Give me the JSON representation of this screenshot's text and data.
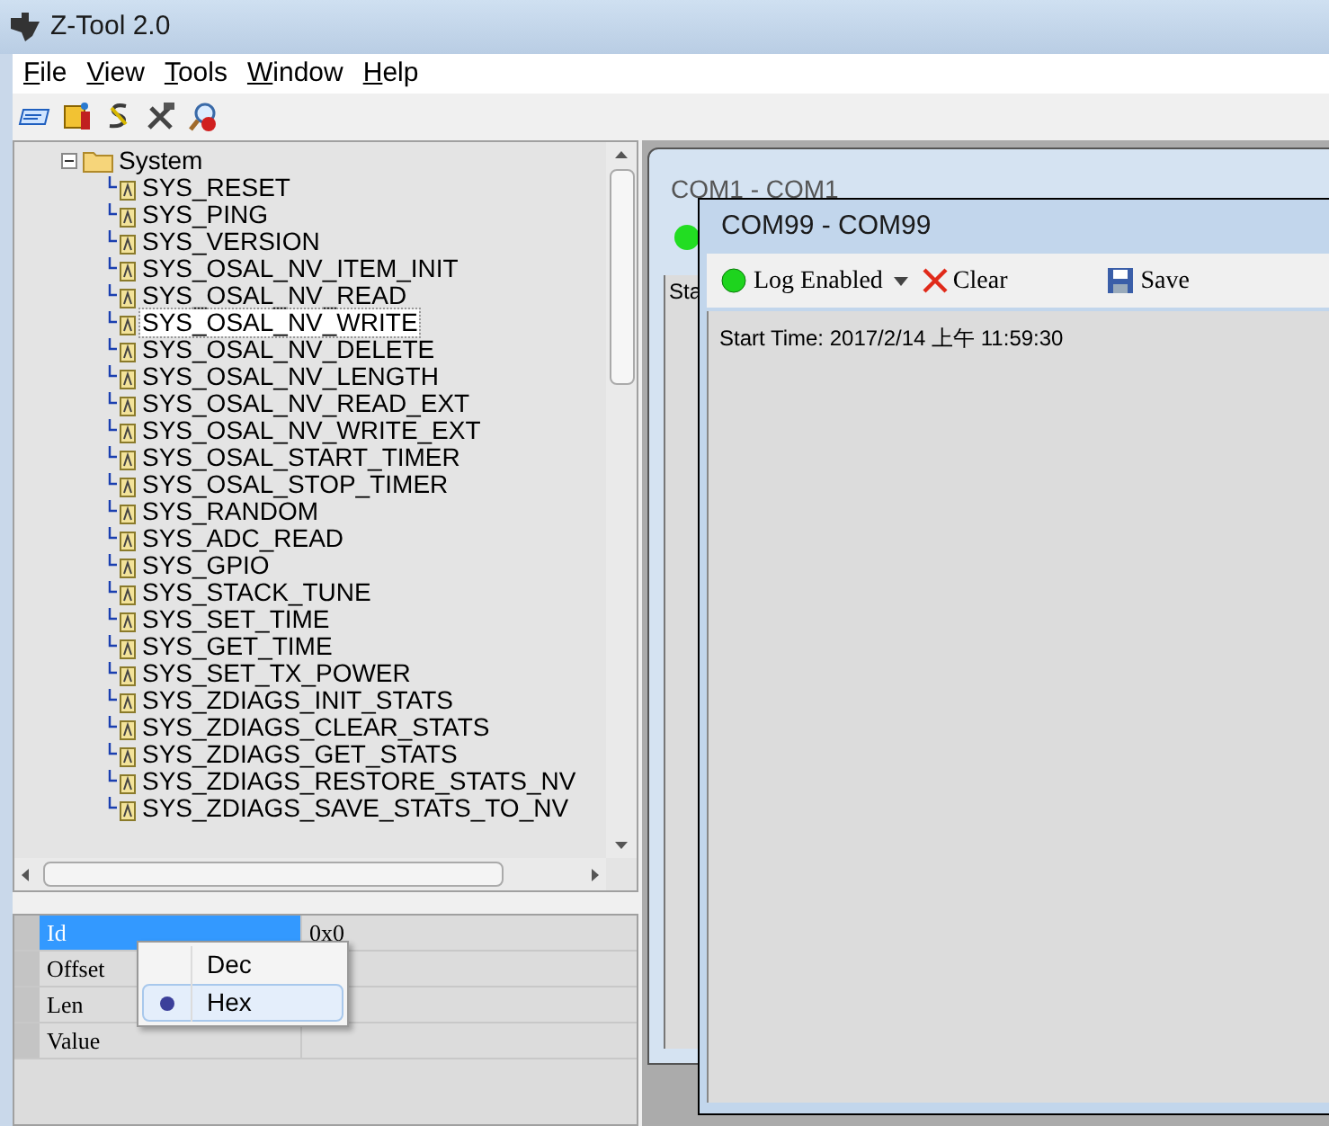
{
  "window": {
    "title": "Z-Tool 2.0"
  },
  "menu": [
    "File",
    "View",
    "Tools",
    "Window",
    "Help"
  ],
  "tree": {
    "label": "System",
    "expanded": true,
    "children": [
      {
        "label": "SYS_RESET",
        "selected": false
      },
      {
        "label": "SYS_PING",
        "selected": false
      },
      {
        "label": "SYS_VERSION",
        "selected": false
      },
      {
        "label": "SYS_OSAL_NV_ITEM_INIT",
        "selected": false
      },
      {
        "label": "SYS_OSAL_NV_READ",
        "selected": false
      },
      {
        "label": "SYS_OSAL_NV_WRITE",
        "selected": true
      },
      {
        "label": "SYS_OSAL_NV_DELETE",
        "selected": false
      },
      {
        "label": "SYS_OSAL_NV_LENGTH",
        "selected": false
      },
      {
        "label": "SYS_OSAL_NV_READ_EXT",
        "selected": false
      },
      {
        "label": "SYS_OSAL_NV_WRITE_EXT",
        "selected": false
      },
      {
        "label": "SYS_OSAL_START_TIMER",
        "selected": false
      },
      {
        "label": "SYS_OSAL_STOP_TIMER",
        "selected": false
      },
      {
        "label": "SYS_RANDOM",
        "selected": false
      },
      {
        "label": "SYS_ADC_READ",
        "selected": false
      },
      {
        "label": "SYS_GPIO",
        "selected": false
      },
      {
        "label": "SYS_STACK_TUNE",
        "selected": false
      },
      {
        "label": "SYS_SET_TIME",
        "selected": false
      },
      {
        "label": "SYS_GET_TIME",
        "selected": false
      },
      {
        "label": "SYS_SET_TX_POWER",
        "selected": false
      },
      {
        "label": "SYS_ZDIAGS_INIT_STATS",
        "selected": false
      },
      {
        "label": "SYS_ZDIAGS_CLEAR_STATS",
        "selected": false
      },
      {
        "label": "SYS_ZDIAGS_GET_STATS",
        "selected": false
      },
      {
        "label": "SYS_ZDIAGS_RESTORE_STATS_NV",
        "selected": false
      },
      {
        "label": "SYS_ZDIAGS_SAVE_STATS_TO_NV",
        "selected": false
      }
    ]
  },
  "properties": [
    {
      "name": "Id",
      "value": "0x0",
      "selected": true
    },
    {
      "name": "Offset",
      "selected": false
    },
    {
      "name": "Len",
      "selected": false
    },
    {
      "name": "Value",
      "selected": false
    }
  ],
  "context_menu": [
    {
      "label": "Dec",
      "selected": false
    },
    {
      "label": "Hex",
      "selected": true
    }
  ],
  "back_window": {
    "title": "COM1 - COM1",
    "log_text": "Sta"
  },
  "front_window": {
    "title": "COM99 - COM99",
    "log_enabled": true,
    "log_button": "Log Enabled",
    "clear_button": "Clear",
    "save_button": "Save",
    "log_text": "Start Time: 2017/2/14 上午 11:59:30"
  }
}
